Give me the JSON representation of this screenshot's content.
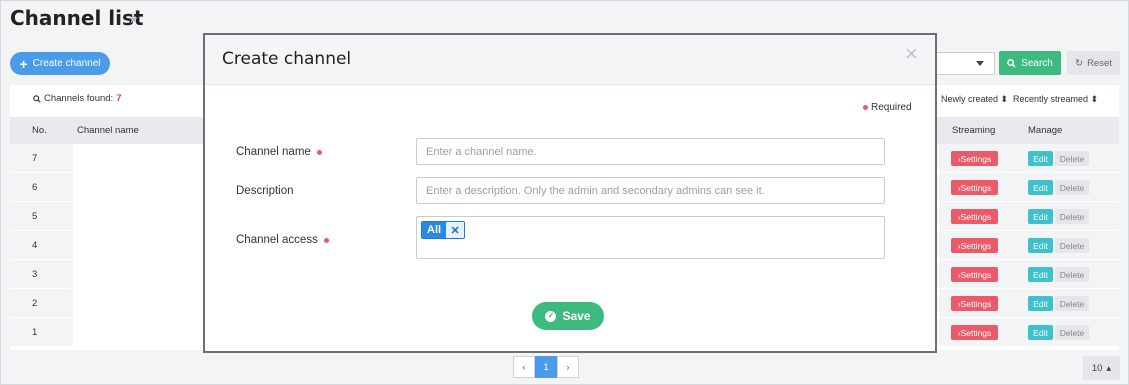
{
  "page": {
    "title": "Channel list",
    "star_icon": "star-icon"
  },
  "toolbar": {
    "create_label": "Create channel",
    "search_label": "Search",
    "reset_label": "Reset"
  },
  "list": {
    "found_label": "Channels found:",
    "found_count": "7",
    "sort_newly": "Newly created",
    "sort_recent": "Recently streamed",
    "headers": {
      "no": "No.",
      "name": "Channel name",
      "streaming": "Streaming",
      "manage": "Manage"
    },
    "rows": [
      {
        "no": "7",
        "settings": "Settings",
        "edit": "Edit",
        "delete": "Delete"
      },
      {
        "no": "6",
        "settings": "Settings",
        "edit": "Edit",
        "delete": "Delete"
      },
      {
        "no": "5",
        "settings": "Settings",
        "edit": "Edit",
        "delete": "Delete"
      },
      {
        "no": "4",
        "settings": "Settings",
        "edit": "Edit",
        "delete": "Delete"
      },
      {
        "no": "3",
        "settings": "Settings",
        "edit": "Edit",
        "delete": "Delete"
      },
      {
        "no": "2",
        "settings": "Settings",
        "edit": "Edit",
        "delete": "Delete"
      },
      {
        "no": "1",
        "settings": "Settings",
        "edit": "Edit",
        "delete": "Delete"
      }
    ]
  },
  "pagination": {
    "current": "1",
    "per_page": "10"
  },
  "modal": {
    "title": "Create channel",
    "required_label": "Required",
    "channel_name_label": "Channel name",
    "channel_name_placeholder": "Enter a channel name.",
    "description_label": "Description",
    "description_placeholder": "Enter a description. Only the admin and secondary admins can see it.",
    "access_label": "Channel access",
    "access_tag": "All",
    "save_label": "Save"
  },
  "colors": {
    "primary": "#4a9be8",
    "success": "#3dbb7e",
    "danger": "#ea5a68",
    "info": "#3fc0cd"
  }
}
